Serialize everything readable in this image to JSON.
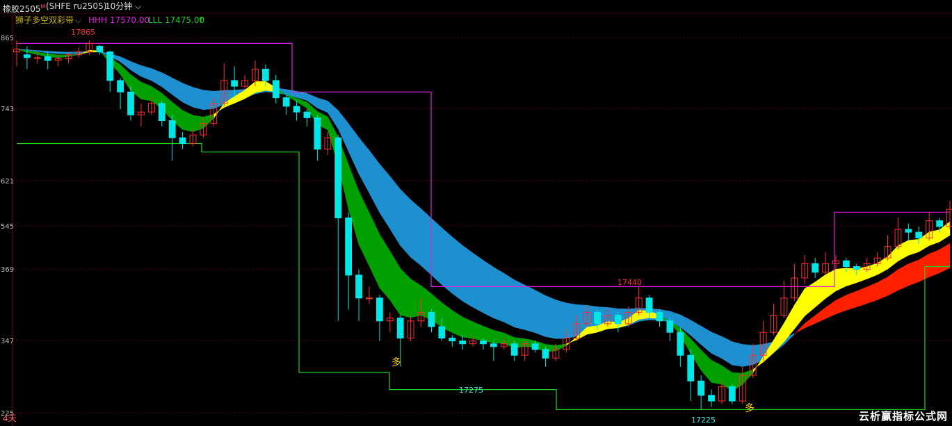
{
  "header": {
    "symbol": "橡胶2505",
    "symbol_mark": "M",
    "exchange_code": "(SHFE ru2505)",
    "period": "10分钟",
    "period_dropdown_icon": "chevron-down-icon"
  },
  "indicator": {
    "name": "狮子多空双彩带",
    "dropdown_icon": "chevron-down-icon",
    "hhh_label": "HHH 17570.00",
    "lll_label": "LLL 17475.00",
    "lll_arrow": "↑",
    "colors": {
      "name": "#c8b400",
      "hhh": "#e020e0",
      "lll": "#20d020"
    }
  },
  "footer": {
    "span_label": "4天"
  },
  "watermark": "云析赢指标公式网",
  "chart_data": {
    "type": "candlestick",
    "y_axis_ticks": [
      "865",
      "743",
      "621",
      "545",
      "369",
      "347",
      "225"
    ],
    "annotations": [
      {
        "text": "17865",
        "color": "#ff3030"
      },
      {
        "text": "17440",
        "color": "#ff3030"
      },
      {
        "text": "17275",
        "color": "#40e0e0"
      },
      {
        "text": "17225",
        "color": "#40e0e0"
      },
      {
        "text": "多",
        "color": "#ffd700"
      },
      {
        "text": "多",
        "color": "#ffd700"
      }
    ],
    "colors": {
      "up_candle": "#ff3030",
      "down_candle": "#00e5e5",
      "fast_band_bull": "#ffff00",
      "fast_band_bear": "#00a000",
      "slow_band_bull": "#ff2000",
      "slow_band_bear": "#1e90d0",
      "hhh_line": "#e020e0",
      "lll_line": "#20d020",
      "grid": "#5a0000",
      "background": "#000000"
    },
    "hhh_steps": [
      17865,
      17865,
      17780,
      17780,
      17440,
      17440,
      17570
    ],
    "lll_steps": [
      17690,
      17675,
      17290,
      17260,
      17225,
      17225,
      17475
    ],
    "candles": [
      [
        17850,
        17855,
        17825,
        17870
      ],
      [
        17845,
        17840,
        17820,
        17860
      ],
      [
        17840,
        17840,
        17830,
        17850
      ],
      [
        17842,
        17835,
        17820,
        17850
      ],
      [
        17835,
        17838,
        17825,
        17845
      ],
      [
        17838,
        17845,
        17830,
        17850
      ],
      [
        17845,
        17850,
        17840,
        17858
      ],
      [
        17850,
        17865,
        17845,
        17870
      ],
      [
        17860,
        17850,
        17845,
        17862
      ],
      [
        17850,
        17800,
        17780,
        17852
      ],
      [
        17800,
        17780,
        17750,
        17805
      ],
      [
        17780,
        17740,
        17730,
        17790
      ],
      [
        17740,
        17745,
        17720,
        17760
      ],
      [
        17745,
        17760,
        17740,
        17770
      ],
      [
        17760,
        17730,
        17720,
        17765
      ],
      [
        17730,
        17700,
        17660,
        17740
      ],
      [
        17700,
        17690,
        17680,
        17710
      ],
      [
        17690,
        17705,
        17685,
        17715
      ],
      [
        17705,
        17725,
        17700,
        17735
      ],
      [
        17725,
        17760,
        17720,
        17770
      ],
      [
        17760,
        17800,
        17755,
        17830
      ],
      [
        17800,
        17790,
        17770,
        17825
      ],
      [
        17790,
        17800,
        17785,
        17810
      ],
      [
        17800,
        17820,
        17790,
        17835
      ],
      [
        17820,
        17800,
        17790,
        17828
      ],
      [
        17800,
        17770,
        17760,
        17810
      ],
      [
        17770,
        17755,
        17740,
        17775
      ],
      [
        17755,
        17745,
        17730,
        17765
      ],
      [
        17745,
        17735,
        17720,
        17750
      ],
      [
        17735,
        17680,
        17660,
        17740
      ],
      [
        17680,
        17700,
        17670,
        17710
      ],
      [
        17700,
        17560,
        17380,
        17705
      ],
      [
        17560,
        17460,
        17400,
        17570
      ],
      [
        17460,
        17420,
        17380,
        17470
      ],
      [
        17420,
        17420,
        17410,
        17440
      ],
      [
        17420,
        17380,
        17345,
        17425
      ],
      [
        17380,
        17385,
        17360,
        17395
      ],
      [
        17385,
        17350,
        17300,
        17390
      ],
      [
        17350,
        17380,
        17345,
        17390
      ],
      [
        17380,
        17395,
        17370,
        17420
      ],
      [
        17395,
        17370,
        17360,
        17400
      ],
      [
        17370,
        17350,
        17345,
        17385
      ],
      [
        17350,
        17345,
        17335,
        17355
      ],
      [
        17345,
        17340,
        17330,
        17355
      ],
      [
        17340,
        17345,
        17335,
        17355
      ],
      [
        17345,
        17340,
        17330,
        17350
      ],
      [
        17340,
        17335,
        17310,
        17345
      ],
      [
        17335,
        17340,
        17330,
        17350
      ],
      [
        17340,
        17320,
        17310,
        17345
      ],
      [
        17320,
        17340,
        17310,
        17345
      ],
      [
        17340,
        17330,
        17325,
        17345
      ],
      [
        17330,
        17315,
        17300,
        17335
      ],
      [
        17315,
        17330,
        17310,
        17340
      ],
      [
        17330,
        17350,
        17325,
        17365
      ],
      [
        17350,
        17375,
        17345,
        17390
      ],
      [
        17375,
        17395,
        17370,
        17405
      ],
      [
        17395,
        17375,
        17365,
        17400
      ],
      [
        17375,
        17390,
        17370,
        17400
      ],
      [
        17390,
        17375,
        17360,
        17395
      ],
      [
        17375,
        17395,
        17370,
        17405
      ],
      [
        17395,
        17420,
        17390,
        17440
      ],
      [
        17420,
        17395,
        17385,
        17425
      ],
      [
        17395,
        17380,
        17370,
        17400
      ],
      [
        17380,
        17360,
        17345,
        17385
      ],
      [
        17360,
        17320,
        17300,
        17370
      ],
      [
        17320,
        17275,
        17240,
        17330
      ],
      [
        17275,
        17250,
        17225,
        17285
      ],
      [
        17250,
        17240,
        17230,
        17260
      ],
      [
        17240,
        17265,
        17235,
        17275
      ],
      [
        17265,
        17240,
        17235,
        17270
      ],
      [
        17240,
        17285,
        17235,
        17300
      ],
      [
        17285,
        17320,
        17280,
        17340
      ],
      [
        17320,
        17360,
        17310,
        17380
      ],
      [
        17360,
        17390,
        17355,
        17410
      ],
      [
        17390,
        17420,
        17385,
        17450
      ],
      [
        17420,
        17455,
        17415,
        17480
      ],
      [
        17455,
        17480,
        17445,
        17495
      ],
      [
        17480,
        17465,
        17455,
        17490
      ],
      [
        17465,
        17480,
        17460,
        17500
      ],
      [
        17480,
        17485,
        17470,
        17495
      ],
      [
        17485,
        17475,
        17465,
        17490
      ],
      [
        17475,
        17470,
        17460,
        17480
      ],
      [
        17470,
        17480,
        17465,
        17490
      ],
      [
        17480,
        17490,
        17475,
        17500
      ],
      [
        17490,
        17510,
        17485,
        17530
      ],
      [
        17510,
        17540,
        17505,
        17560
      ],
      [
        17540,
        17535,
        17520,
        17550
      ],
      [
        17535,
        17525,
        17515,
        17545
      ],
      [
        17525,
        17555,
        17520,
        17570
      ],
      [
        17555,
        17545,
        17535,
        17560
      ],
      [
        17545,
        17575,
        17540,
        17590
      ]
    ]
  }
}
